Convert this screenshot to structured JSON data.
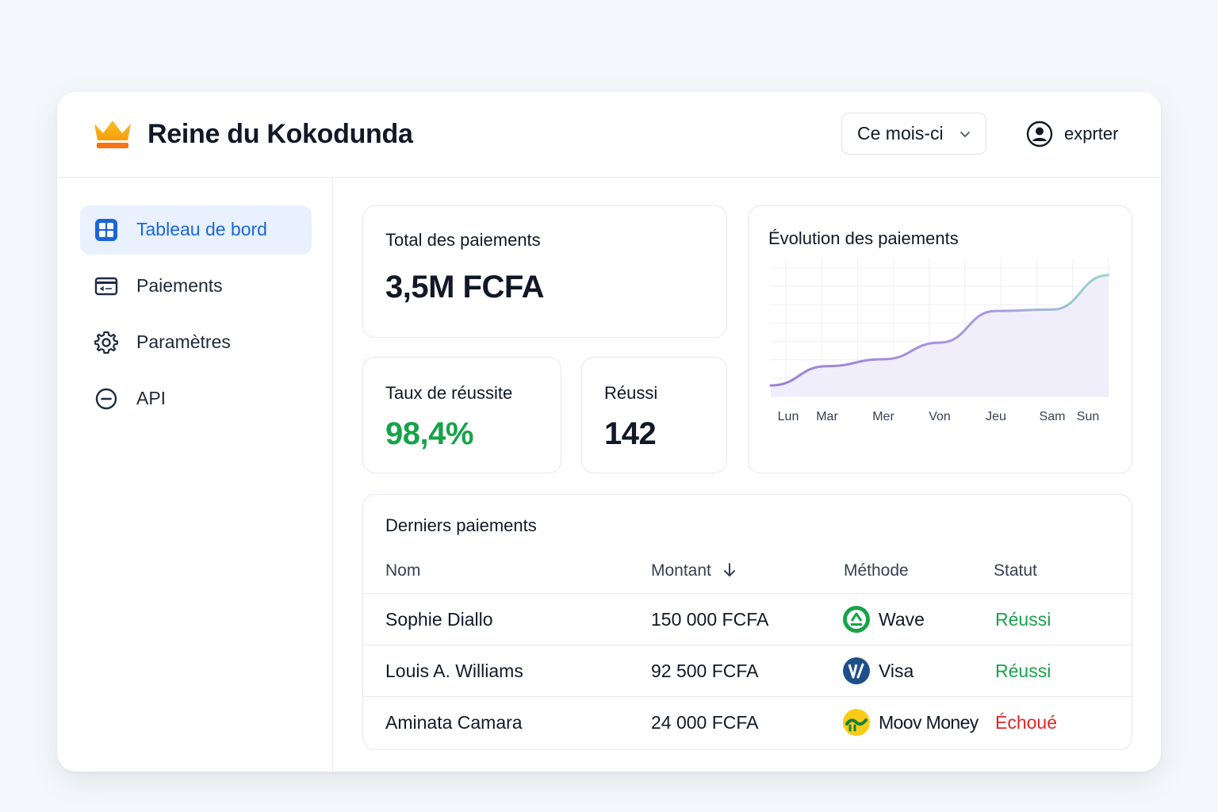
{
  "header": {
    "title": "Reine du Kokodunda",
    "period_select": "Ce mois-ci",
    "user_label": "exprter"
  },
  "sidebar": {
    "items": [
      {
        "label": "Tableau de bord",
        "icon": "dashboard-grid-icon",
        "active": true
      },
      {
        "label": "Paiements",
        "icon": "payment-card-icon",
        "active": false
      },
      {
        "label": "Paramètres",
        "icon": "gear-icon",
        "active": false
      },
      {
        "label": "API",
        "icon": "api-circle-icon",
        "active": false
      }
    ]
  },
  "stats": {
    "total": {
      "label": "Total des paiements",
      "value": "3,5M FCFA"
    },
    "rate": {
      "label": "Taux de réussite",
      "value": "98,4%"
    },
    "success": {
      "label": "Réussi",
      "value": "142"
    }
  },
  "chart_data": {
    "type": "area",
    "title": "Évolution des paiements",
    "categories": [
      "Lun",
      "Mar",
      "Mer",
      "Von",
      "Jeu",
      "Sam",
      "Sun"
    ],
    "values": [
      8,
      22,
      27,
      39,
      62,
      63,
      88
    ],
    "ylim": [
      0,
      100
    ],
    "grid": true,
    "colors": {
      "line_start": "#9b7fd6",
      "line_end": "#98d8c8",
      "fill": "#f1eefb"
    }
  },
  "table": {
    "title": "Derniers paiements",
    "columns": [
      "Nom",
      "Montant",
      "Méthode",
      "Statut"
    ],
    "rows": [
      {
        "name": "Sophie Diallo",
        "amount": "150 000 FCFA",
        "method": "Wave",
        "method_icon": "wave-logo-icon",
        "status": "Réussi",
        "ok": true
      },
      {
        "name": "Louis A. Williams",
        "amount": "92 500 FCFA",
        "method": "Visa",
        "method_icon": "visa-logo-icon",
        "status": "Réussi",
        "ok": true
      },
      {
        "name": "Aminata Camara",
        "amount": "24 000 FCFA",
        "method": "Moov Money",
        "method_icon": "moov-money-logo-icon",
        "status": "Échoué",
        "ok": false
      }
    ]
  },
  "colors": {
    "accent": "#1a66d9",
    "success": "#16a34a",
    "error": "#dc2626",
    "crown": "#f59e0b"
  }
}
